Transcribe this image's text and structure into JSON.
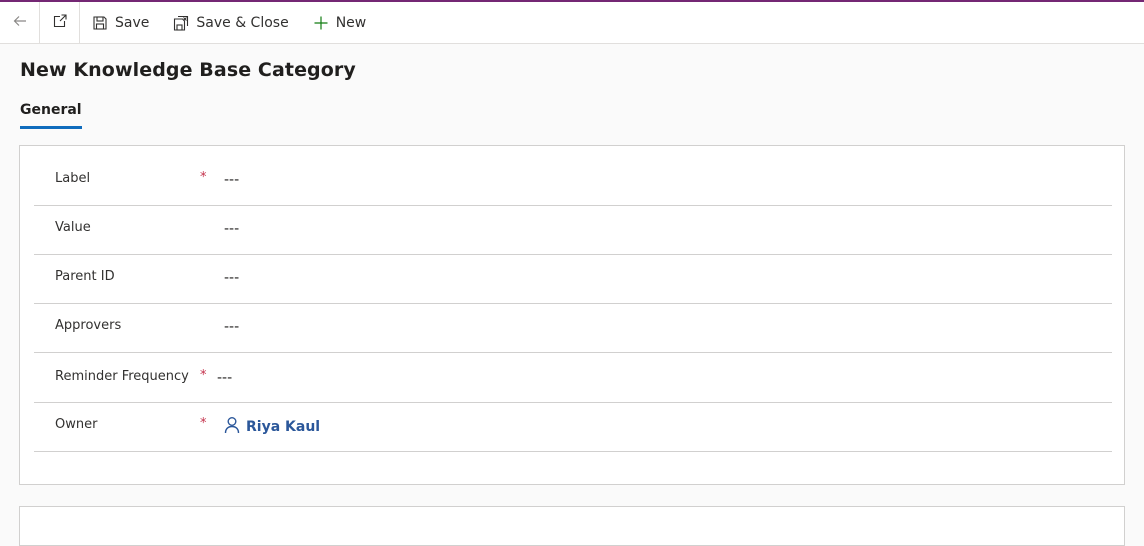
{
  "colors": {
    "accent_topline": "#742774",
    "tab_underline": "#0f6cbd",
    "required": "#c4314b",
    "link": "#2b579a",
    "new_plus": "#107c10"
  },
  "toolbar": {
    "back_icon": "back-arrow-icon",
    "popout_icon": "open-in-new-window-icon",
    "save_label": "Save",
    "save_close_label": "Save & Close",
    "new_label": "New"
  },
  "page": {
    "title": "New Knowledge Base Category"
  },
  "tabs": [
    {
      "label": "General",
      "selected": true
    }
  ],
  "form": {
    "fields": [
      {
        "label": "Label",
        "required": "*",
        "value": "---"
      },
      {
        "label": "Value",
        "required": "",
        "value": "---"
      },
      {
        "label": "Parent ID",
        "required": "",
        "value": "---"
      },
      {
        "label": "Approvers",
        "required": "",
        "value": "---"
      },
      {
        "label": "Reminder Frequency",
        "required": "*",
        "value": "---"
      },
      {
        "label": "Owner",
        "required": "*",
        "value": "Riya Kaul",
        "icon": "person-icon"
      }
    ]
  }
}
